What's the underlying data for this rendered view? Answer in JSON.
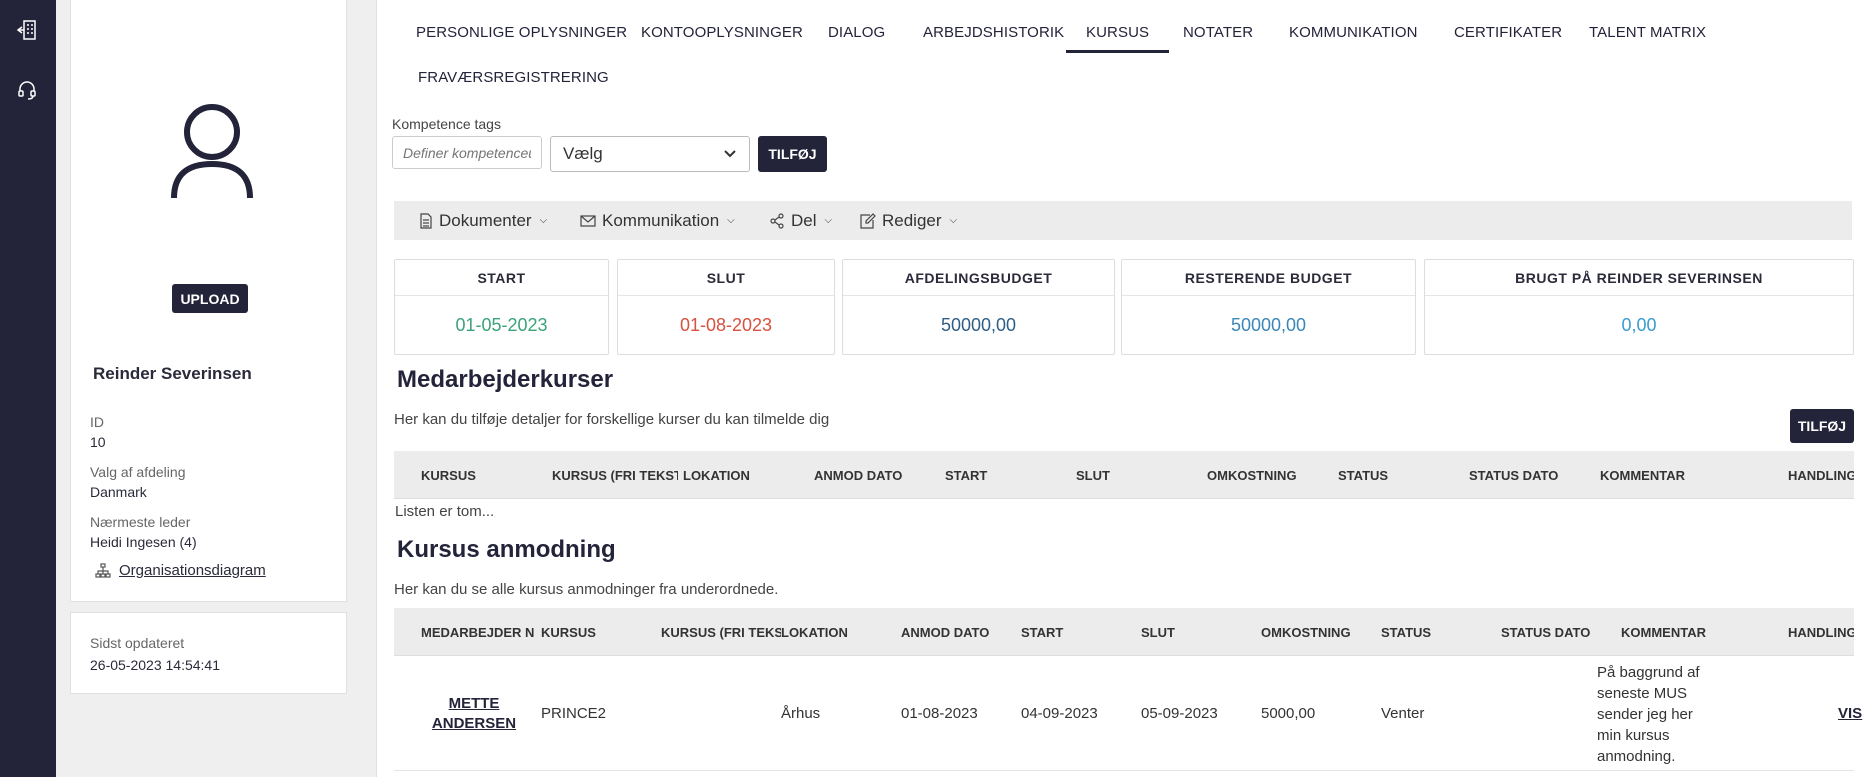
{
  "rail": {
    "icons": [
      "building-exit-icon",
      "support-headset-icon"
    ]
  },
  "profile": {
    "upload_label": "UPLOAD",
    "name": "Reinder Severinsen",
    "id_label": "ID",
    "id_value": "10",
    "dept_label": "Valg af afdeling",
    "dept_value": "Danmark",
    "manager_label": "Nærmeste leder",
    "manager_value": "Heidi Ingesen (4)",
    "org_link": "Organisationsdiagram",
    "updated_label": "Sidst opdateret",
    "updated_value": "26-05-2023 14:54:41"
  },
  "tabs": [
    "PERSONLIGE OPLYSNINGER",
    "KONTOOPLYSNINGER",
    "DIALOG",
    "ARBEJDSHISTORIK",
    "KURSUS",
    "NOTATER",
    "KOMMUNIKATION",
    "CERTIFIKATER",
    "TALENT MATRIX",
    "FRAVÆRSREGISTRERING"
  ],
  "active_tab": "KURSUS",
  "kompetence": {
    "label": "Kompetence tags",
    "placeholder": "Definer kompetenceudv",
    "select_value": "Vælg",
    "add_label": "TILFØJ"
  },
  "toolbar": {
    "documents": "Dokumenter",
    "communication": "Kommunikation",
    "share": "Del",
    "edit": "Rediger"
  },
  "stats": [
    {
      "title": "START",
      "value": "01-05-2023",
      "color": "#3aa37a"
    },
    {
      "title": "SLUT",
      "value": "01-08-2023",
      "color": "#d9503f"
    },
    {
      "title": "AFDELINGSBUDGET",
      "value": "50000,00",
      "color": "#2e5e86"
    },
    {
      "title": "RESTERENDE BUDGET",
      "value": "50000,00",
      "color": "#3a86b8"
    },
    {
      "title": "BRUGT PÅ REINDER SEVERINSEN",
      "value": "0,00",
      "color": "#3a9bd0"
    }
  ],
  "employee_courses": {
    "title": "Medarbejderkurser",
    "description": "Her kan du tilføje detaljer for forskellige kurser du kan tilmelde dig",
    "add_label": "TILFØJ",
    "columns": [
      "KURSUS",
      "KURSUS (FRI TEKST)",
      "LOKATION",
      "ANMOD DATO",
      "START",
      "SLUT",
      "OMKOSTNING",
      "STATUS",
      "STATUS DATO",
      "KOMMENTAR",
      "HANDLING"
    ],
    "empty_text": "Listen er tom..."
  },
  "course_requests": {
    "title": "Kursus anmodning",
    "description": "Her kan du se alle kursus anmodninger fra underordnede.",
    "columns": [
      "MEDARBEJDER NAVN",
      "KURSUS",
      "KURSUS (FRI TEKST)",
      "LOKATION",
      "ANMOD DATO",
      "START",
      "SLUT",
      "OMKOSTNING",
      "STATUS",
      "STATUS DATO",
      "KOMMENTAR",
      "HANDLING"
    ],
    "rows": [
      {
        "employee": "METTE ANDERSEN",
        "course": "PRINCE2",
        "course_free": "",
        "location": "Århus",
        "request_date": "01-08-2023",
        "start": "04-09-2023",
        "end": "05-09-2023",
        "cost": "5000,00",
        "status": "Venter",
        "status_date": "",
        "comment": "På baggrund af seneste MUS sender jeg her min kursus anmodning.",
        "action": "VIS"
      }
    ]
  }
}
